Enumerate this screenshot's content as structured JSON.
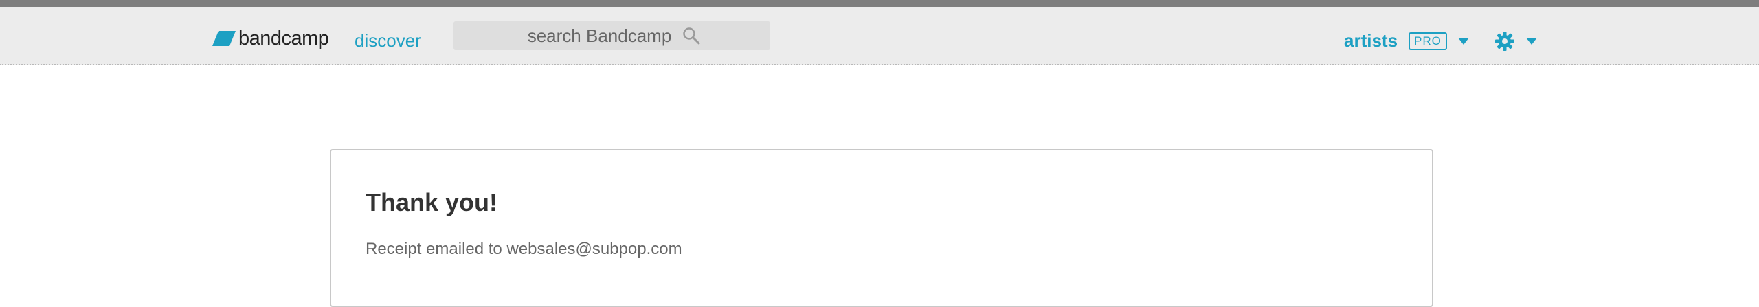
{
  "header": {
    "logo_text": "bandcamp",
    "discover_label": "discover",
    "search_placeholder": "search Bandcamp",
    "artists_label": "artists",
    "pro_badge": "PRO"
  },
  "colors": {
    "accent": "#1da0c3",
    "header_bg": "#ececec",
    "top_strip": "#7e7e7e",
    "text_dark": "#333333",
    "text_muted": "#666666"
  },
  "icons": [
    "bandcamp-logo-icon",
    "search-icon",
    "caret-down-icon",
    "gear-icon"
  ],
  "main": {
    "title": "Thank you!",
    "receipt_text": "Receipt emailed to websales@subpop.com"
  }
}
